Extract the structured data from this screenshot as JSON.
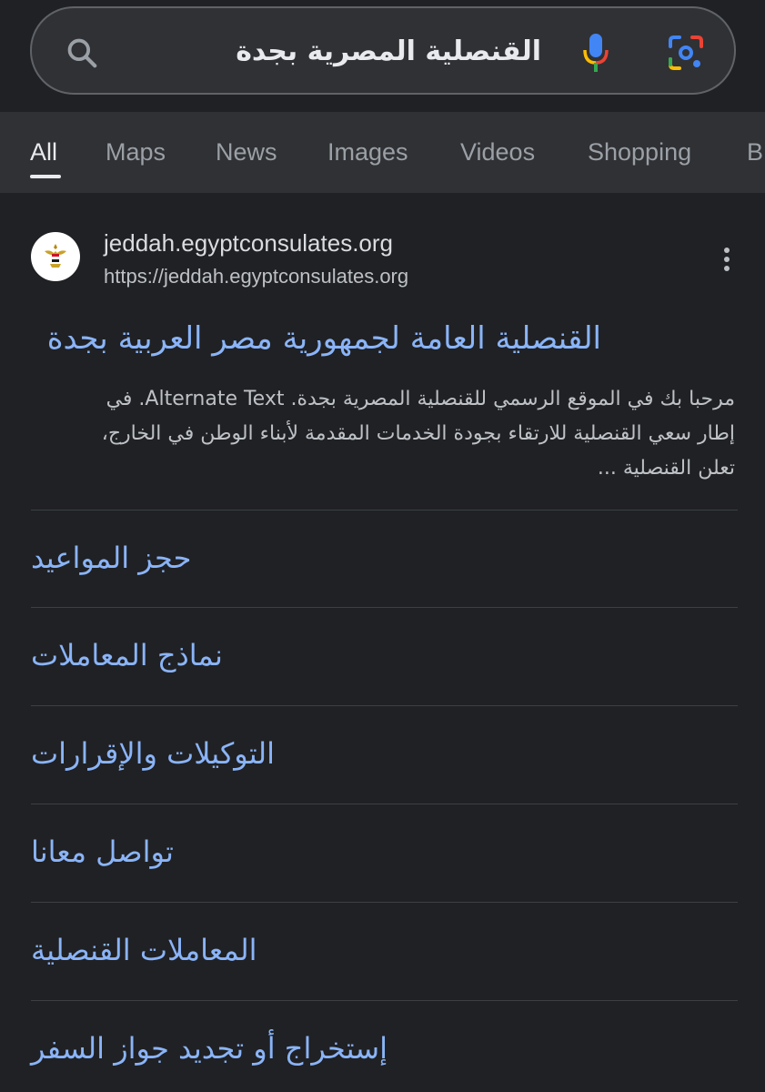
{
  "search": {
    "query": "القنصلية المصرية بجدة",
    "icons": [
      "search-icon",
      "mic-icon",
      "lens-icon"
    ]
  },
  "tabs": [
    {
      "label": "All",
      "active": true
    },
    {
      "label": "Maps",
      "active": false
    },
    {
      "label": "News",
      "active": false
    },
    {
      "label": "Images",
      "active": false
    },
    {
      "label": "Videos",
      "active": false
    },
    {
      "label": "Shopping",
      "active": false
    },
    {
      "label": "B",
      "active": false
    }
  ],
  "result": {
    "site_name": "jeddah.egyptconsulates.org",
    "url": "https://jeddah.egyptconsulates.org",
    "title": "القنصلية العامة لجمهورية مصر العربية بجدة",
    "snippet_lines": [
      "مرحبا بك في الموقع الرسمي للقنصلية المصرية بجدة. Alternate Text. في",
      "إطار سعي القنصلية للارتقاء بجودة الخدمات المقدمة لأبناء الوطن في الخارج،",
      "تعلن القنصلية ..."
    ]
  },
  "sitelinks": [
    "حجز المواعيد",
    "نماذج المعاملات",
    "التوكيلات والإقرارات",
    "تواصل معانا",
    "المعاملات القنصلية",
    "إستخراج أو تجديد جواز السفر"
  ],
  "colors": {
    "background": "#202124",
    "link": "#8ab4f8",
    "text": "#e8eaed",
    "muted": "#9aa0a6"
  }
}
